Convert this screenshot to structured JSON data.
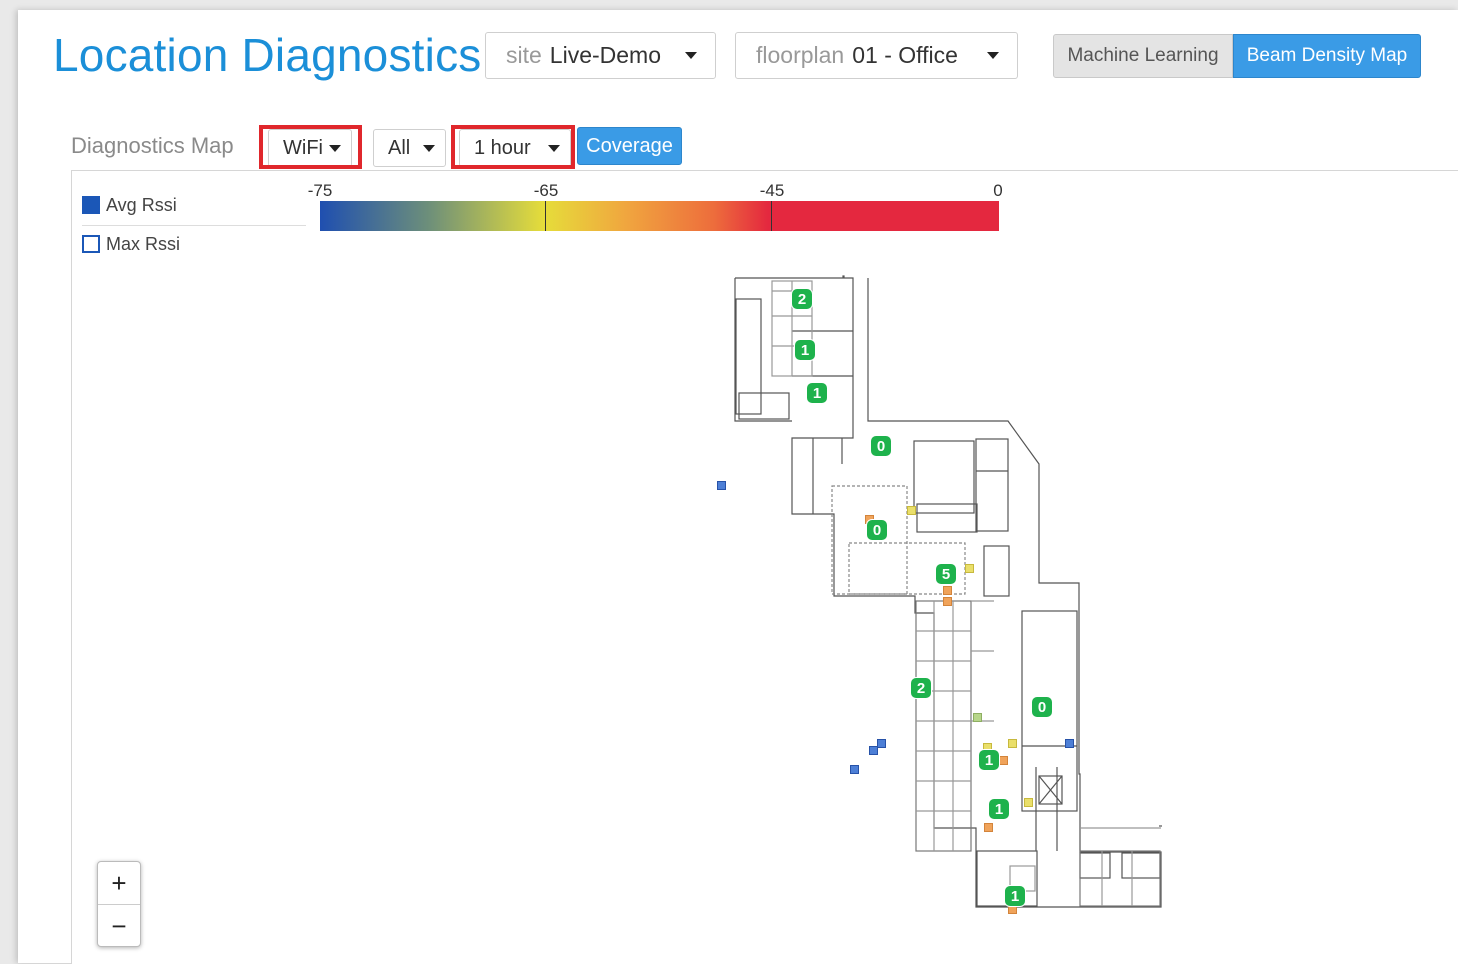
{
  "header": {
    "title": "Location Diagnostics",
    "site": {
      "label": "site",
      "value": "Live-Demo"
    },
    "floorplan": {
      "label": "floorplan",
      "value": "01 - Office"
    },
    "view_toggle": {
      "machine_learning": "Machine Learning",
      "beam_density_map": "Beam Density Map",
      "active": "Beam Density Map"
    }
  },
  "toolbar": {
    "label": "Diagnostics Map",
    "type_select": "WiFi",
    "filter_select": "All",
    "time_select": "1 hour",
    "coverage_button": "Coverage",
    "highlight_color": "#e0272c"
  },
  "legend": {
    "avg_label": "Avg Rssi",
    "max_label": "Max Rssi",
    "scale_ticks": [
      "-75",
      "-65",
      "-45",
      "0"
    ],
    "colors": {
      "low": "#1f4fb0",
      "mid": "#e6dd3a",
      "high": "#e4283f"
    }
  },
  "map": {
    "badges": [
      "2",
      "1",
      "1",
      "0",
      "0",
      "5",
      "2",
      "0",
      "1",
      "1",
      "1"
    ]
  },
  "zoom": {
    "in": "+",
    "out": "−"
  }
}
